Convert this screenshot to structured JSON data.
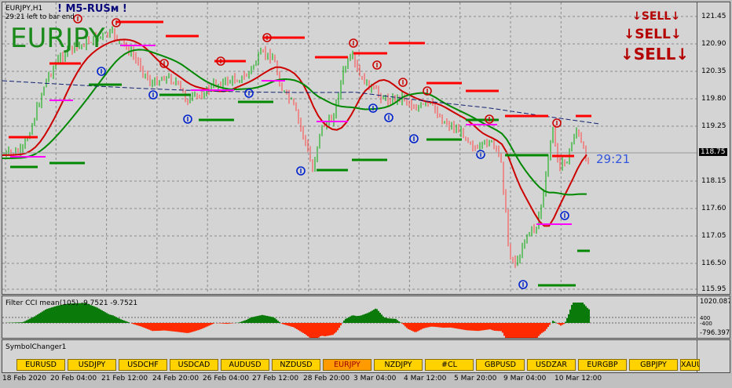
{
  "window": {
    "symbol_timeframe": "EURJPY,H1",
    "bar_timer": "29:21 left to bar end",
    "brand": "! M5-RUSм !",
    "big_symbol": "EURJPY",
    "countdown": "29:21",
    "signal": [
      "SELL",
      "SELL",
      "SELL"
    ]
  },
  "price_axis": {
    "labels": [
      "121.45",
      "120.90",
      "120.35",
      "119.80",
      "119.25",
      "118.75",
      "118.15",
      "117.60",
      "117.05",
      "116.50",
      "115.95"
    ],
    "current_price": "118.75"
  },
  "cci_panel": {
    "title": "Filter CCI mean(105) -9.7521 -9.7521",
    "axis_labels": [
      "1020.087",
      "400",
      "-400",
      "-796.3973"
    ]
  },
  "symbol_changer": {
    "title": "SymbolChanger1",
    "symbols": [
      "EURUSD",
      "USDJPY",
      "USDCHF",
      "USDCAD",
      "AUDUSD",
      "NZDUSD",
      "EURJPY",
      "NZDJPY",
      "#CL",
      "GBPUSD",
      "USDZAR",
      "EURGBP",
      "GBPJPY",
      "XAUU"
    ],
    "active": "EURJPY"
  },
  "time_axis": [
    "18 Feb 2020",
    "20 Feb 04:00",
    "21 Feb 12:00",
    "24 Feb 20:00",
    "26 Feb 04:00",
    "27 Feb 12:00",
    "28 Feb 20:00",
    "3 Mar 04:00",
    "4 Mar 12:00",
    "5 Mar 20:00",
    "9 Mar 04:00",
    "10 Mar 12:00"
  ],
  "colors": {
    "background": "#d4d4d4",
    "bull": "#00aa00",
    "bear": "#ff4444",
    "sell_signal": "#cc0000",
    "buy_signal": "#0022cc",
    "level_red": "#ff0000",
    "level_green": "#008800",
    "level_magenta": "#ff00ff",
    "button": "#ffd200"
  }
}
